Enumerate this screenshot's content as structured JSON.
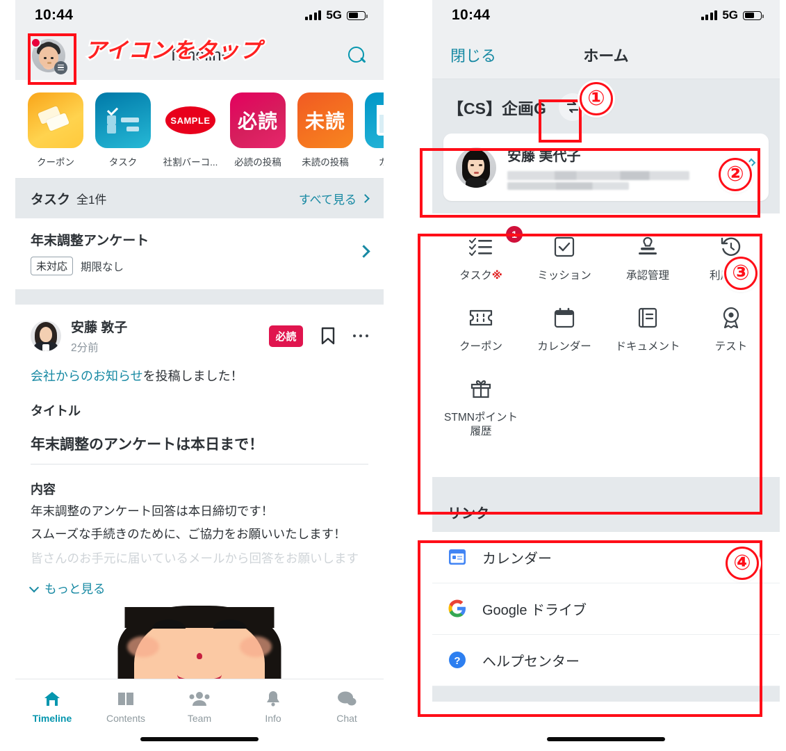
{
  "annotation": {
    "tap_icon_text": "アイコンをタップ",
    "numbers": [
      "①",
      "②",
      "③",
      "④"
    ],
    "accent_color": "#ff0e18"
  },
  "left_phone": {
    "status": {
      "time": "10:44",
      "network": "5G"
    },
    "header": {
      "title": "Timeline",
      "search_icon": "search-icon",
      "avatar_icon": "user-avatar"
    },
    "tiles": [
      {
        "label": "クーポン",
        "icon": "coupon-ticket-icon"
      },
      {
        "label": "タスク",
        "icon": "checklist-icon"
      },
      {
        "label": "社割バーコ...",
        "icon": "sample-barcode-icon",
        "badge_text": "SAMPLE"
      },
      {
        "label": "必読の投稿",
        "icon": "must-read-icon",
        "glyph": "必読"
      },
      {
        "label": "未読の投稿",
        "icon": "unread-icon",
        "glyph": "未読"
      },
      {
        "label": "カレン",
        "icon": "calendar-icon"
      }
    ],
    "task_section": {
      "title": "タスク",
      "count": "全1件",
      "see_all": "すべて見る",
      "item": {
        "name": "年末調整アンケート",
        "status": "未対応",
        "due": "期限なし"
      }
    },
    "post": {
      "author": "安藤 敦子",
      "time": "2分前",
      "must_read_badge": "必読",
      "notice_link": "会社からのお知らせ",
      "notice_rest": "を投稿しました！",
      "label_title": "タイトル",
      "headline": "年末調整のアンケートは本日まで！",
      "label_body": "内容",
      "body_line1": "年末調整のアンケート回答は本日締切です！",
      "body_line2": "スムーズな手続きのために、ご協力をお願いいたします！",
      "body_faded": "皆さんのお手元に届いているメールから回答をお願いします",
      "more": "もっと見る"
    },
    "tabs": [
      {
        "label": "Timeline",
        "icon": "home-icon",
        "active": true
      },
      {
        "label": "Contents",
        "icon": "book-icon",
        "active": false
      },
      {
        "label": "Team",
        "icon": "people-icon",
        "active": false
      },
      {
        "label": "Info",
        "icon": "bell-icon",
        "active": false
      },
      {
        "label": "Chat",
        "icon": "chat-bubble-icon",
        "active": false
      }
    ]
  },
  "right_phone": {
    "status": {
      "time": "10:44",
      "network": "5G"
    },
    "nav": {
      "close": "閉じる",
      "title": "ホーム"
    },
    "group": {
      "name": "【CS】企画G",
      "swap_icon": "swap-arrows-icon"
    },
    "profile": {
      "name": "安藤 美代子",
      "edit_icon": "pencil-icon",
      "avatar": "user-avatar"
    },
    "grid": [
      {
        "label": "タスク",
        "suffix": "※",
        "icon": "checklist-icon",
        "badge": "1"
      },
      {
        "label": "ミッション",
        "icon": "checkbox-icon"
      },
      {
        "label": "承認管理",
        "icon": "stamp-icon"
      },
      {
        "label": "利用履歴",
        "icon": "history-clock-icon"
      },
      {
        "label": "クーポン",
        "icon": "ticket-icon"
      },
      {
        "label": "カレンダー",
        "icon": "calendar-icon"
      },
      {
        "label": "ドキュメント",
        "icon": "document-icon"
      },
      {
        "label": "テスト",
        "icon": "award-icon"
      },
      {
        "label": "STMNポイント履歴",
        "icon": "gift-icon"
      }
    ],
    "links_title": "リンク",
    "links": [
      {
        "label": "カレンダー",
        "icon": "calendar-app-icon"
      },
      {
        "label": "Google ドライブ",
        "icon": "google-icon"
      },
      {
        "label": "ヘルプセンター",
        "icon": "help-question-icon"
      }
    ]
  }
}
